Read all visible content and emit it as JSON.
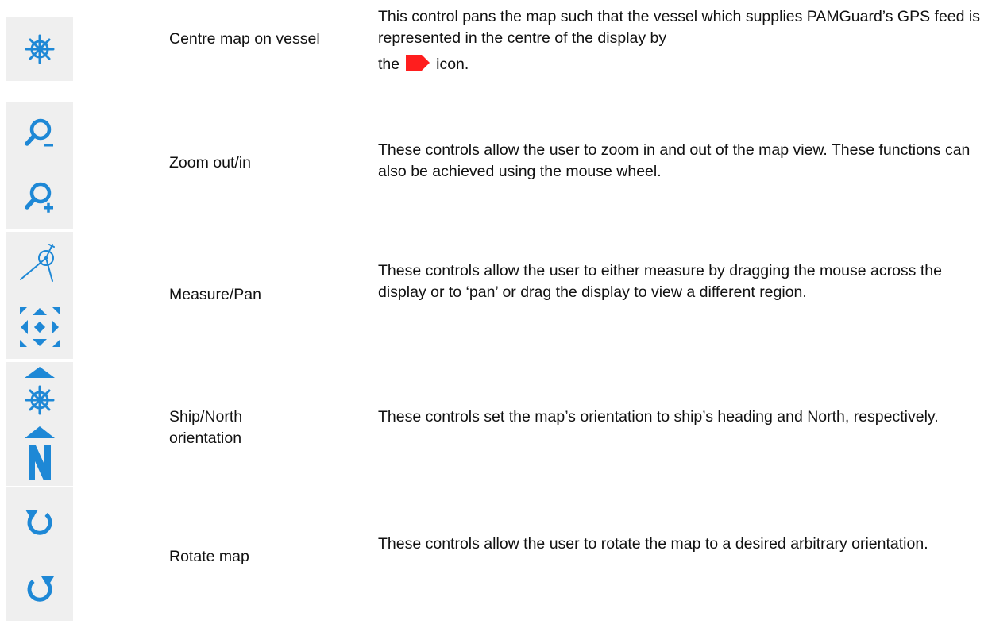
{
  "accent_color": "#1e88d6",
  "vessel_marker_color": "#ff1e1e",
  "rows": [
    {
      "label": "Centre map on vessel",
      "icons": [
        "ship-wheel-icon"
      ],
      "description_line1": "This control pans the map such that the vessel which supplies PAMGuard’s GPS feed is represented in the centre of the display by",
      "description_before_marker": "the",
      "description_after_marker": "icon.",
      "marker_icon": "red-vessel-marker-icon"
    },
    {
      "label": "Zoom out/in",
      "icons": [
        "zoom-out-icon",
        "zoom-in-icon"
      ],
      "description": "These controls allow the user to zoom in and out of the map view. These functions can also be achieved using the mouse wheel."
    },
    {
      "label": "Measure/Pan",
      "icons": [
        "measure-compass-icon",
        "pan-arrows-icon"
      ],
      "description": "These controls allow the user to either measure by dragging the mouse across the display or to ‘pan’ or drag the display to view a different region."
    },
    {
      "label": "Ship/North orientation",
      "icons": [
        "ship-heading-icon",
        "north-up-icon"
      ],
      "description": "These controls set the map’s orientation to ship’s heading and North, respectively."
    },
    {
      "label": "Rotate map",
      "icons": [
        "rotate-counterclockwise-icon",
        "rotate-clockwise-icon"
      ],
      "description": "These controls allow the user to rotate the map to a desired arbitrary orientation."
    }
  ]
}
